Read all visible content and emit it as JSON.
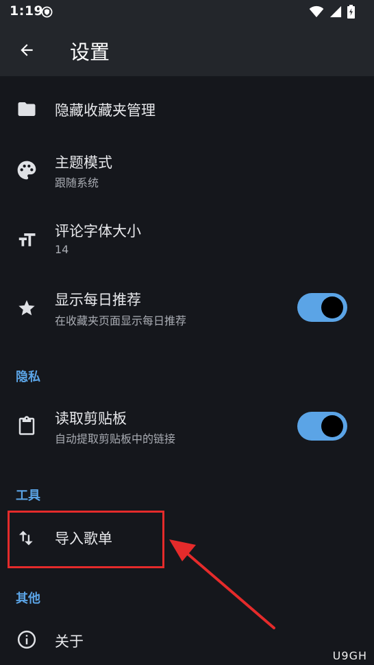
{
  "status_bar": {
    "time": "1:19"
  },
  "app_bar": {
    "title": "设置"
  },
  "items": {
    "hidden_favorites": {
      "title": "隐藏收藏夹管理",
      "icon": "folder-icon"
    },
    "theme_mode": {
      "title": "主题模式",
      "subtitle": "跟随系统",
      "icon": "palette-icon"
    },
    "comment_font_size": {
      "title": "评论字体大小",
      "subtitle": "14",
      "icon": "text-size-icon"
    },
    "daily_recommend": {
      "title": "显示每日推荐",
      "subtitle": "在收藏夹页面显示每日推荐",
      "icon": "star-icon",
      "enabled": true
    },
    "read_clipboard": {
      "title": "读取剪贴板",
      "subtitle": "自动提取剪贴板中的链接",
      "icon": "clipboard-icon",
      "enabled": true
    },
    "import_playlist": {
      "title": "导入歌单",
      "icon": "swap-vertical-icon"
    },
    "about": {
      "title": "关于",
      "icon": "info-icon"
    }
  },
  "sections": {
    "privacy": "隐私",
    "tools": "工具",
    "other": "其他"
  },
  "colors": {
    "accent": "#5ba4e6",
    "background": "#15171c",
    "app_bar": "#23262b",
    "annotation": "#e52b2b"
  },
  "watermark": "U9GH"
}
